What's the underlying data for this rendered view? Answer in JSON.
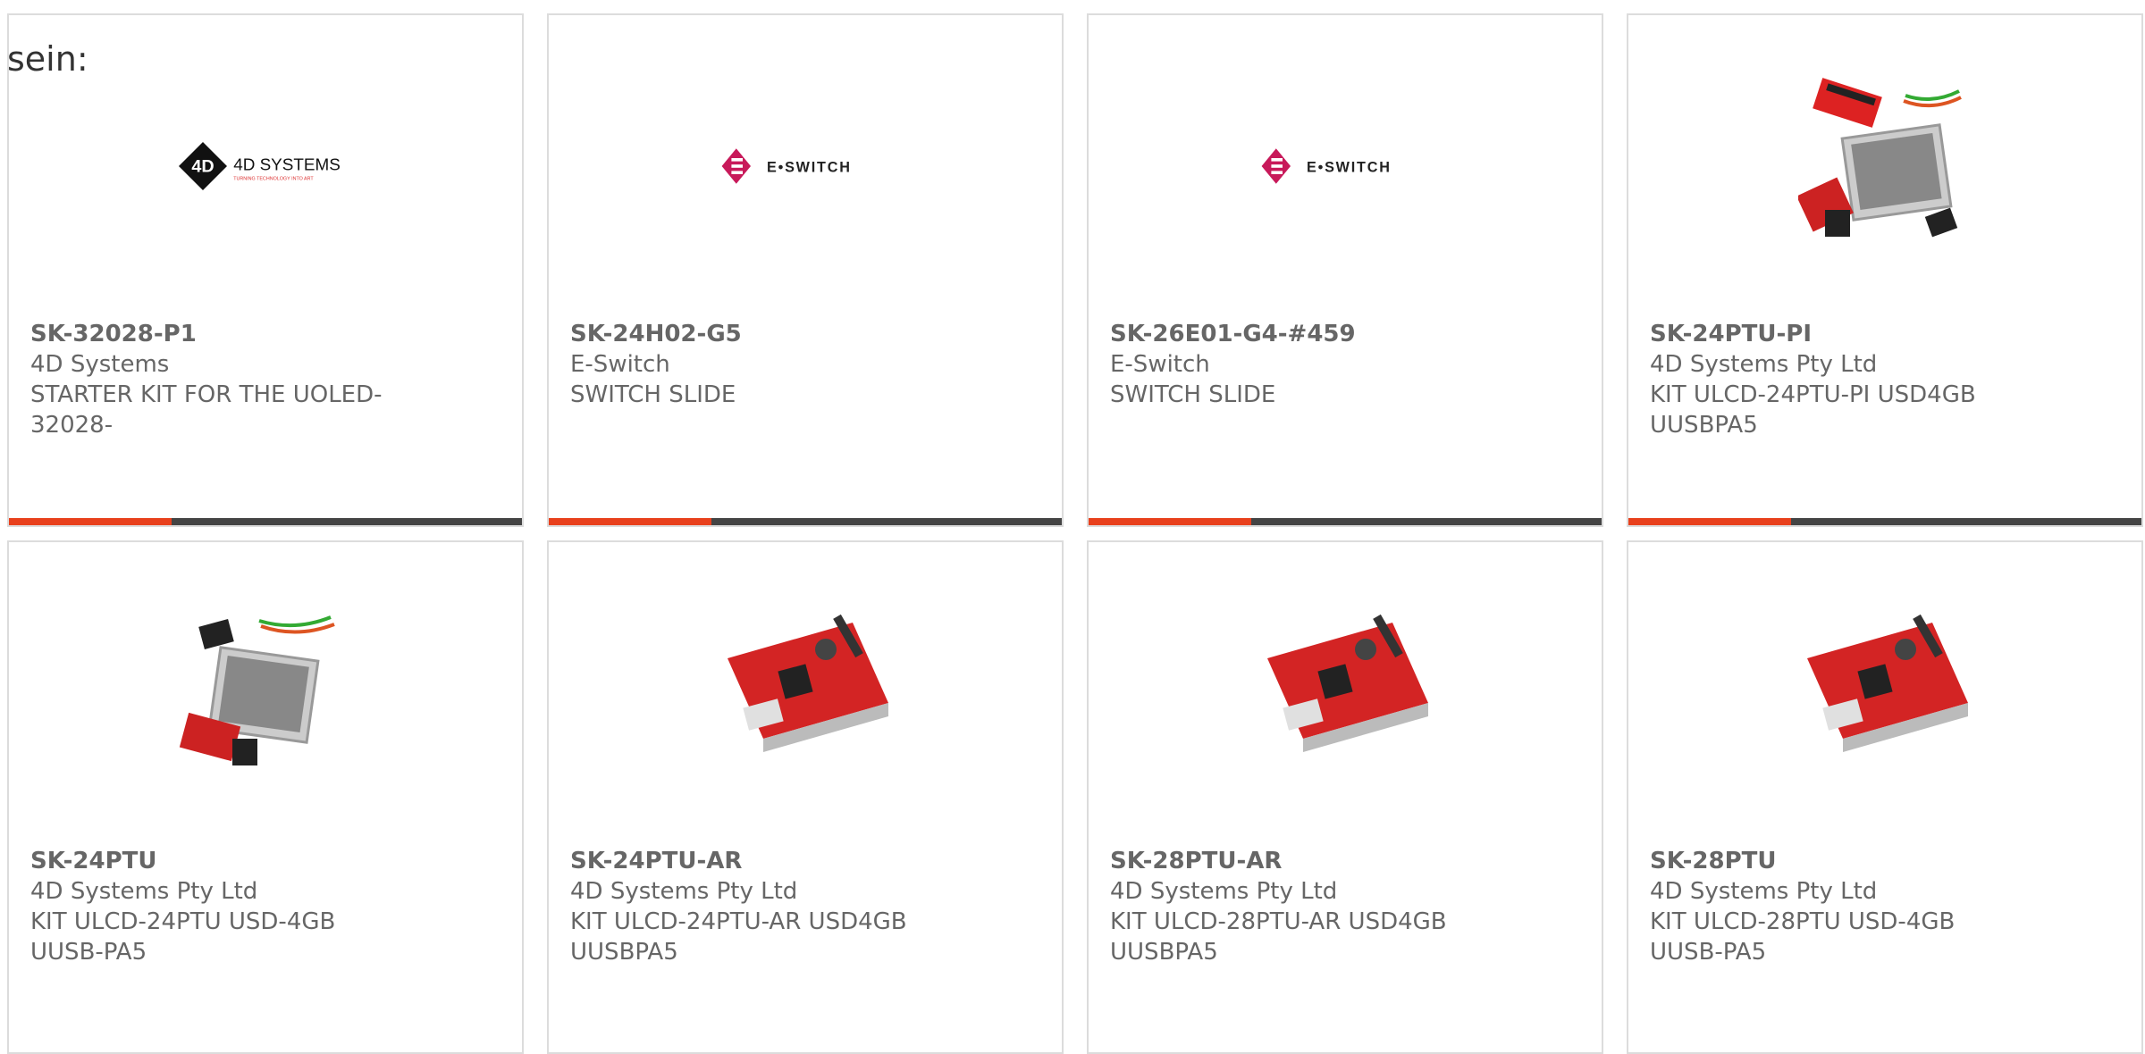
{
  "intro_text": "sein:",
  "colors": {
    "accent": "#e8401c",
    "bar": "#444444",
    "border": "#dcdcdc",
    "text": "#666666"
  },
  "products": [
    {
      "part": "SK-32028-P1",
      "mfr": "4D Systems",
      "desc": "STARTER KIT FOR THE UOLED-32028-",
      "image": "4d-systems-logo",
      "logo_text": "4D SYSTEMS",
      "logo_tag": "TURNING TECHNOLOGY INTO ART"
    },
    {
      "part": "SK-24H02-G5",
      "mfr": "E-Switch",
      "desc": "SWITCH SLIDE",
      "image": "e-switch-logo",
      "logo_text": "E•SWITCH"
    },
    {
      "part": "SK-26E01-G4-#459",
      "mfr": "E-Switch",
      "desc": "SWITCH SLIDE",
      "image": "e-switch-logo",
      "logo_text": "E•SWITCH"
    },
    {
      "part": "SK-24PTU-PI",
      "mfr": "4D Systems Pty Ltd",
      "desc": "KIT ULCD-24PTU-PI USD4GB UUSBPA5",
      "image": "display-kit-photo"
    },
    {
      "part": "SK-24PTU",
      "mfr": "4D Systems Pty Ltd",
      "desc": "KIT ULCD-24PTU USD-4GB UUSB-PA5",
      "image": "display-kit-photo"
    },
    {
      "part": "SK-24PTU-AR",
      "mfr": "4D Systems Pty Ltd",
      "desc": "KIT ULCD-24PTU-AR USD4GB UUSBPA5",
      "image": "red-board-photo"
    },
    {
      "part": "SK-28PTU-AR",
      "mfr": "4D Systems Pty Ltd",
      "desc": "KIT ULCD-28PTU-AR USD4GB UUSBPA5",
      "image": "red-board-photo"
    },
    {
      "part": "SK-28PTU",
      "mfr": "4D Systems Pty Ltd",
      "desc": "KIT ULCD-28PTU USD-4GB UUSB-PA5",
      "image": "red-board-photo"
    }
  ]
}
